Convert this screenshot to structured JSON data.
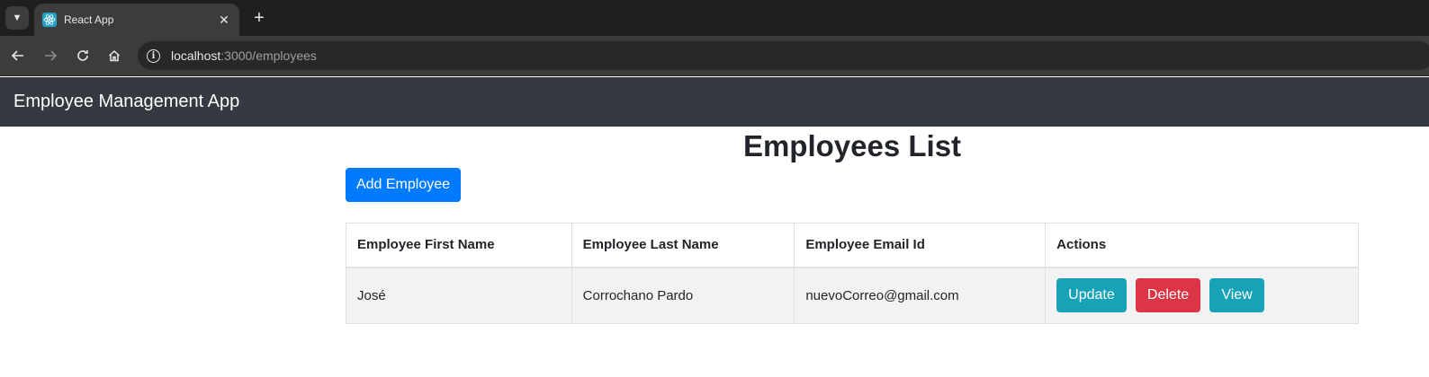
{
  "browser": {
    "tab_title": "React App",
    "tab_close": "✕",
    "new_tab": "+",
    "url_host": "localhost",
    "url_rest": ":3000/employees"
  },
  "app": {
    "brand": "Employee Management App",
    "page_title": "Employees List",
    "add_button": "Add Employee"
  },
  "table": {
    "headers": [
      "Employee First Name",
      "Employee Last Name",
      "Employee Email Id",
      "Actions"
    ],
    "rows": [
      {
        "first_name": "José",
        "last_name": "Corrochano Pardo",
        "email": "nuevoCorreo@gmail.com",
        "actions": {
          "update": "Update",
          "delete": "Delete",
          "view": "View"
        }
      }
    ]
  },
  "colors": {
    "navbar": "#343a40",
    "primary": "#007bff",
    "info": "#17a2b8",
    "danger": "#dc3545"
  }
}
